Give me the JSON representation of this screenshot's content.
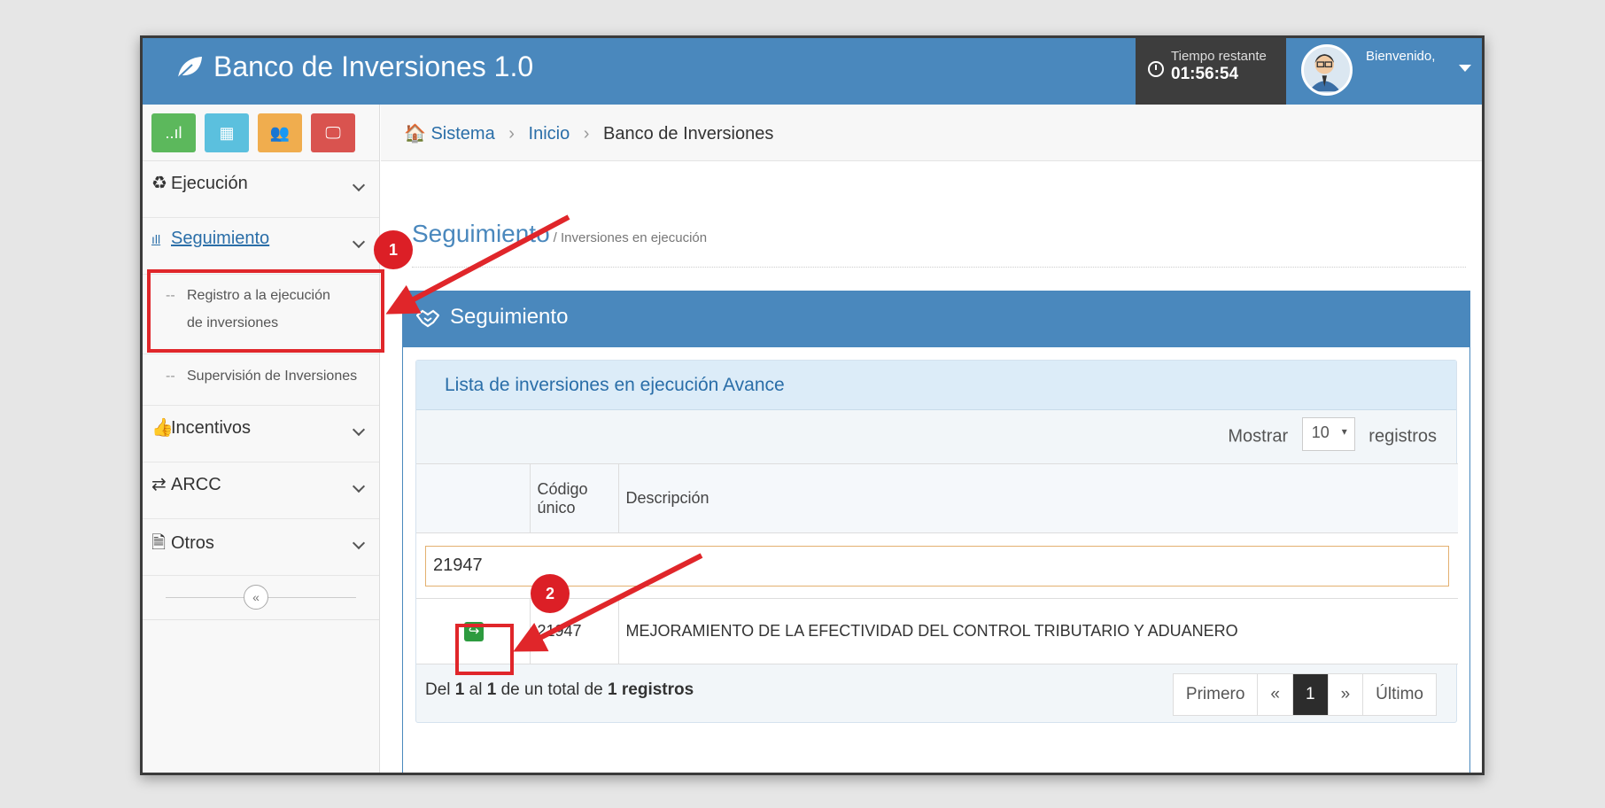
{
  "app": {
    "title": "Banco de Inversiones 1.0"
  },
  "timer": {
    "label": "Tiempo restante",
    "value": "01:56:54"
  },
  "user": {
    "welcome": "Bienvenido,"
  },
  "shortcuts": [
    {
      "icon": "bar-chart-icon",
      "color": "#5cb85c",
      "glyph": "..ıl"
    },
    {
      "icon": "calendar-icon",
      "color": "#5bc0de",
      "glyph": "▦"
    },
    {
      "icon": "users-icon",
      "color": "#f0ad4e",
      "glyph": "👥"
    },
    {
      "icon": "monitor-icon",
      "color": "#d9534f",
      "glyph": "🖵"
    }
  ],
  "sidebar": {
    "ejecucion": "Ejecución",
    "seguimiento": "Seguimiento",
    "registro": "Registro a la ejecución de inversiones",
    "supervision": "Supervisión de Inversiones",
    "incentivos": "Incentivos",
    "arcc": "ARCC",
    "otros": "Otros"
  },
  "breadcrumb": {
    "root": "Sistema",
    "inicio": "Inicio",
    "current": "Banco de Inversiones"
  },
  "page": {
    "title": "Seguimiento",
    "subtitle": "/ Inversiones en ejecución"
  },
  "panel": {
    "title": "Seguimiento"
  },
  "list": {
    "title": "Lista de inversiones en ejecución Avance",
    "show_label": "Mostrar",
    "page_size": "10",
    "records_label": "registros",
    "columns": [
      "",
      "Código único",
      "Descripción"
    ],
    "filter_value": "21947",
    "rows": [
      {
        "codigo": "21947",
        "descripcion": "MEJORAMIENTO DE LA EFECTIVIDAD DEL CONTROL TRIBUTARIO Y ADUANERO"
      }
    ],
    "info_prefix": "Del",
    "info_from": "1",
    "info_mid": "al",
    "info_to": "1",
    "info_total_label": "de un total de",
    "info_total": "1",
    "info_suffix": "registros"
  },
  "pager": {
    "first": "Primero",
    "prev": "«",
    "current": "1",
    "next": "»",
    "last": "Último"
  },
  "annotations": {
    "step1": "1",
    "step2": "2"
  },
  "colors": {
    "primary": "#4a88bd",
    "highlight": "#e0262a",
    "success": "#2d9b3f"
  }
}
